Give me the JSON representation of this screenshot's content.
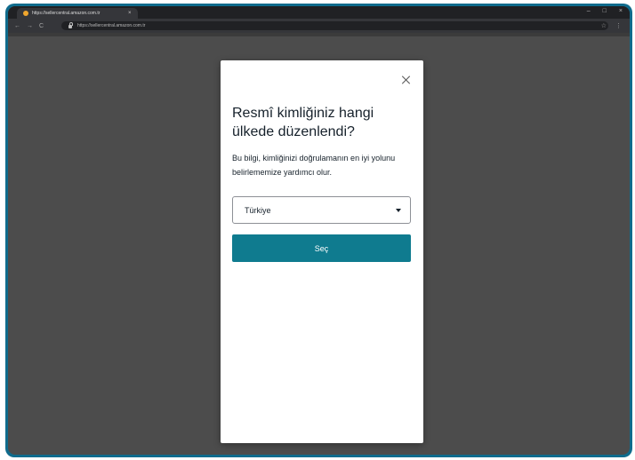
{
  "browser": {
    "tab_title": "https://sellercentral.amazon.com.tr",
    "tab_close": "×",
    "url": "https://sellercentral.amazon.com.tr",
    "nav": {
      "back": "←",
      "forward": "→",
      "reload": "C"
    },
    "window_controls": {
      "minimize": "–",
      "maximize": "□",
      "close": "×"
    },
    "star": "☆",
    "menu": "⋮"
  },
  "modal": {
    "title": "Resmî kimliğiniz hangi ülkede düzenlendi?",
    "description": "Bu bilgi, kimliğinizi doğrulamanın en iyi yolunu belirlememize yardımcı olur.",
    "country_select": {
      "selected": "Türkiye"
    },
    "submit_label": "Seç"
  },
  "colors": {
    "frame": "#0f6b8c",
    "backdrop": "#4c4c4c",
    "primary_button": "#0f7b8f",
    "text": "#16212b"
  }
}
